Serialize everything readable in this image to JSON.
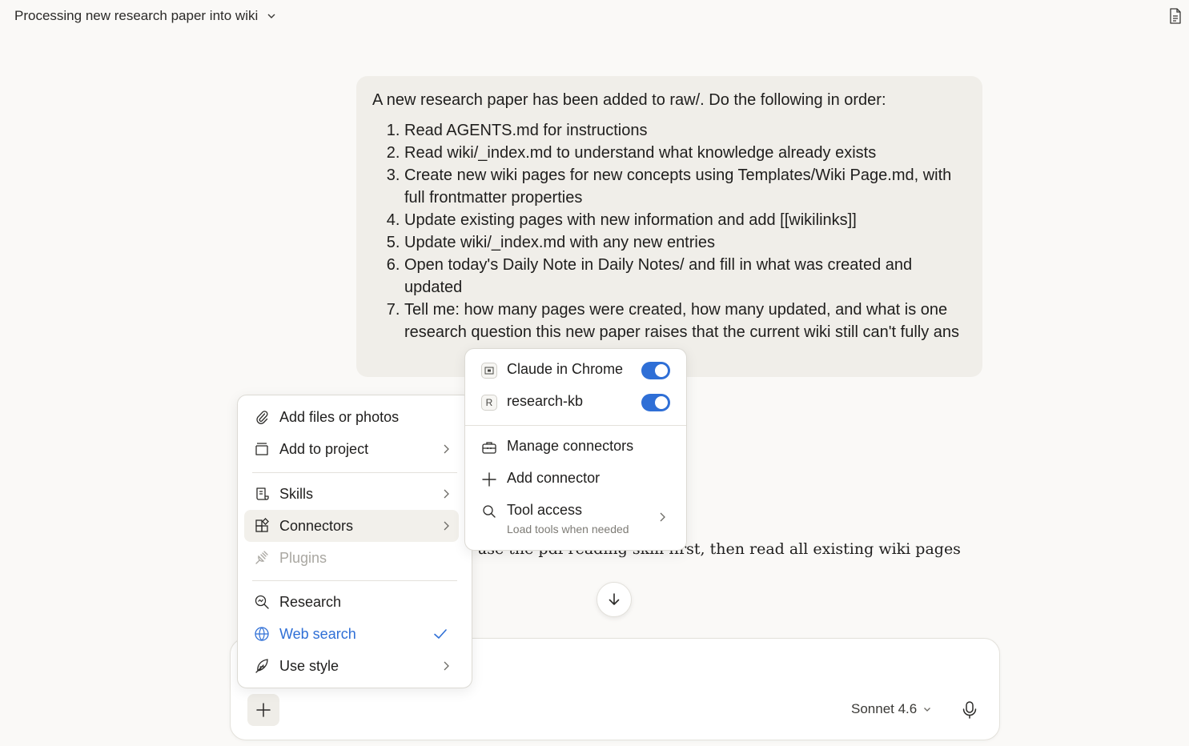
{
  "header": {
    "title": "Processing new research paper into wiki",
    "title_icon": "chevron-down-icon",
    "right_icon": "document-icon"
  },
  "user_message": {
    "intro": "A new research paper has been added to raw/. Do the following in order:",
    "steps": [
      "Read AGENTS.md for instructions",
      "Read wiki/_index.md to understand what knowledge already exists",
      "Create new wiki pages for new concepts using Templates/Wiki Page.md, with full frontmatter properties",
      "Update existing pages with new information and add [[wikilinks]]",
      "Update wiki/_index.md with any new entries",
      "Open today's Daily Note in Daily Notes/ and fill in what was created and updated",
      "Tell me: how many pages were created, how many updated, and what is one research question this new paper raises that the current wiki still can't fully ans"
    ]
  },
  "assistant_message": {
    "visible_text": "use the pdf-reading skill first, then read all existing wiki pages"
  },
  "composer": {
    "model": "Sonnet 4.6"
  },
  "plus_menu": {
    "items": [
      {
        "label": "Add files or photos",
        "icon": "paperclip-icon"
      },
      {
        "label": "Add to project",
        "icon": "project-box-icon",
        "has_submenu": true
      },
      {
        "label": "Skills",
        "icon": "skills-scroll-icon",
        "has_submenu": true
      },
      {
        "label": "Connectors",
        "icon": "connectors-icon",
        "has_submenu": true,
        "highlighted": true
      },
      {
        "label": "Plugins",
        "icon": "plug-icon",
        "disabled": true
      },
      {
        "label": "Research",
        "icon": "research-search-icon"
      },
      {
        "label": "Web search",
        "icon": "globe-icon",
        "checked": true,
        "accent_color": "#2f6fd6"
      },
      {
        "label": "Use style",
        "icon": "feather-pen-icon",
        "has_submenu": true
      }
    ]
  },
  "connectors_menu": {
    "connectors": [
      {
        "label": "Claude in Chrome",
        "icon": "chrome-extension-icon",
        "enabled": true
      },
      {
        "label": "research-kb",
        "badge": "R",
        "enabled": true
      }
    ],
    "actions": [
      {
        "label": "Manage connectors",
        "icon": "toolbox-icon"
      },
      {
        "label": "Add connector",
        "icon": "plus-icon"
      },
      {
        "label": "Tool access",
        "sublabel": "Load tools when needed",
        "icon": "search-icon",
        "has_submenu": true
      }
    ],
    "toggle_color": "#2f6fd6"
  }
}
